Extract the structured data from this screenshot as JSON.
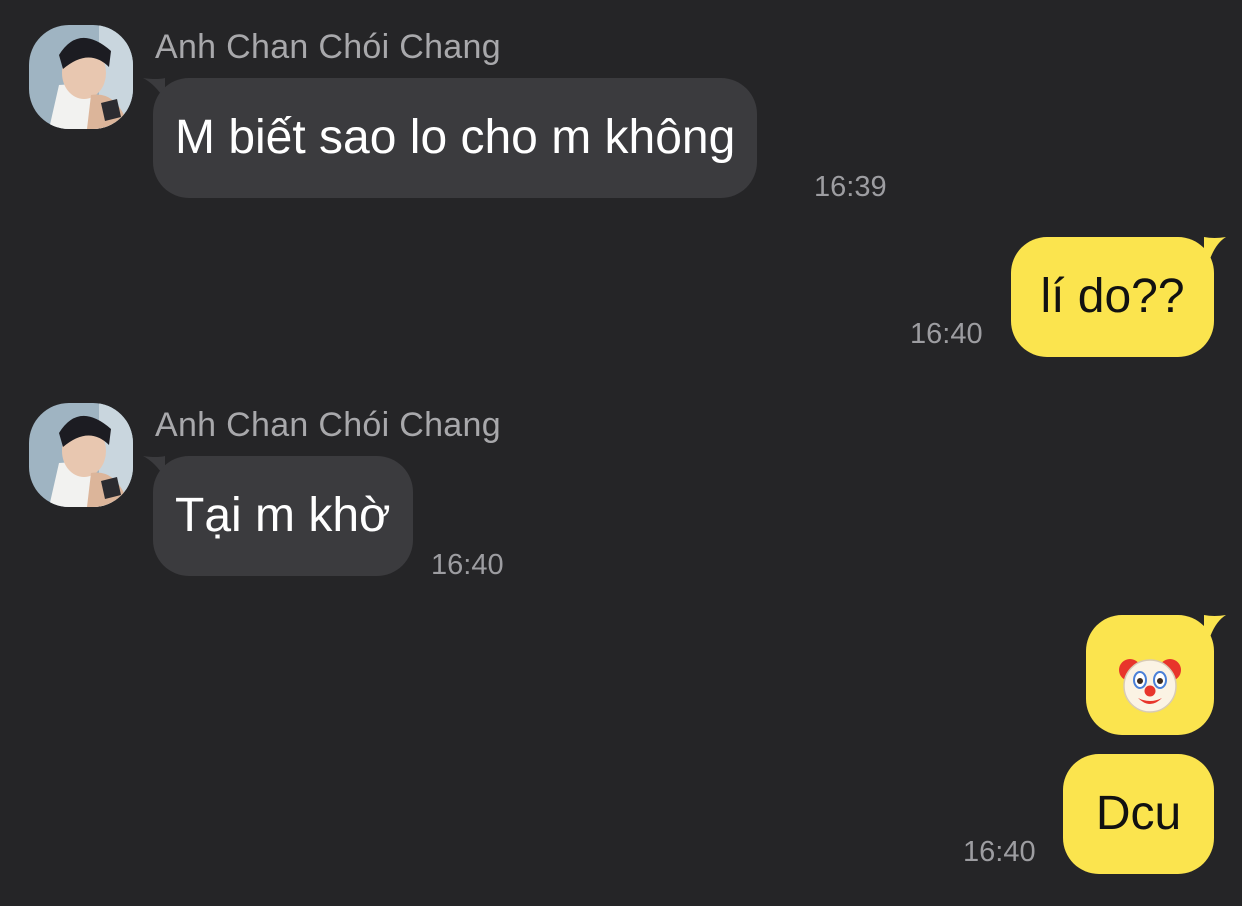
{
  "chat": {
    "messages": [
      {
        "direction": "incoming",
        "sender": "Anh Chan Chói Chang",
        "text": "M biết sao lo cho m không",
        "time": "16:39"
      },
      {
        "direction": "outgoing",
        "text": "lí do??",
        "time": "16:40"
      },
      {
        "direction": "incoming",
        "sender": "Anh Chan Chói Chang",
        "text": "Tại m khờ",
        "time": "16:40"
      },
      {
        "direction": "outgoing",
        "emoji": "clown-face",
        "text": "🤡",
        "time": ""
      },
      {
        "direction": "outgoing",
        "text": "Dcu",
        "time": "16:40"
      }
    ]
  },
  "colors": {
    "background": "#252527",
    "incoming_bubble": "#3b3b3e",
    "outgoing_bubble": "#fbe44e",
    "meta_text": "#9d9da1"
  }
}
